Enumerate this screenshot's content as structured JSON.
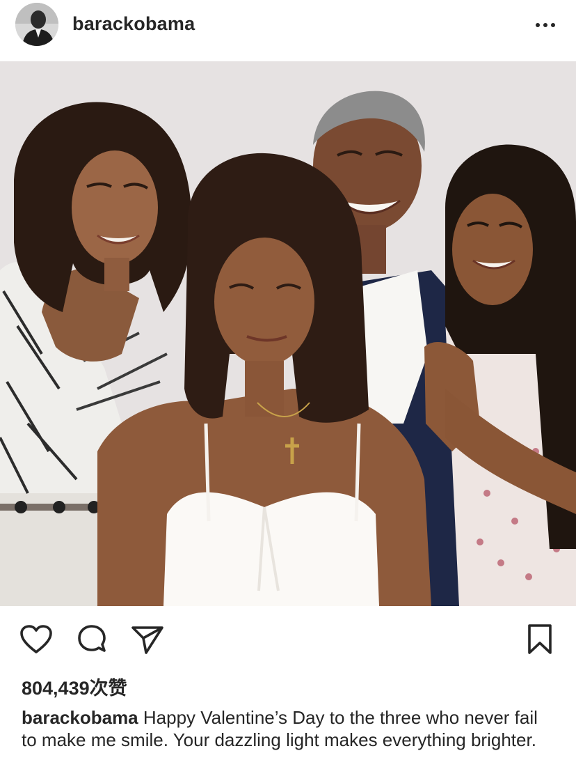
{
  "post": {
    "username": "barackobama",
    "likes_text": "804,439次赞",
    "caption_username": "barackobama",
    "caption_text": " Happy Valentine’s Day to the three who never fail to make me smile. Your dazzling light makes everything brighter."
  },
  "icons": {
    "more": "more-horizontal-icon",
    "like": "heart-outline-icon",
    "comment": "comment-bubble-icon",
    "share": "paper-plane-icon",
    "save": "bookmark-outline-icon"
  },
  "colors": {
    "text": "#262626",
    "background": "#ffffff",
    "photo_backdrop": "#e7e3e3"
  }
}
